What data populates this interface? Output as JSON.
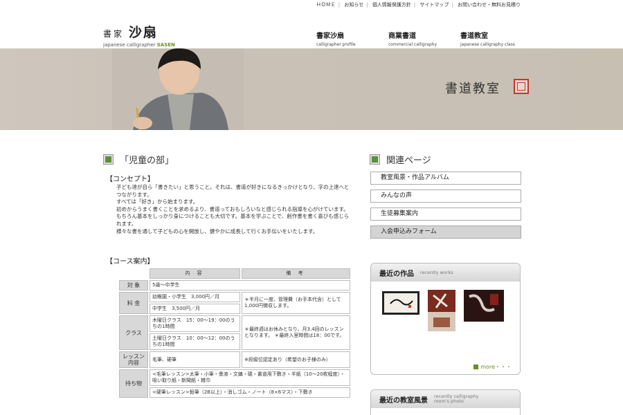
{
  "top_nav": [
    "ＨＯＭＥ",
    "お知らせ",
    "個人情報保護方針",
    "サイトマップ",
    "お問い合わせ・無料お見積り"
  ],
  "logo": {
    "line1_small": "書家",
    "line1_big": "沙扇",
    "line2_prefix": "japanese calligrapher ",
    "line2_accent": "SASEN"
  },
  "main_nav": [
    {
      "jp": "書家沙扇",
      "en": "calligrapher profile"
    },
    {
      "jp": "商業書道",
      "en": "commercial calligraphy"
    },
    {
      "jp": "書道教室",
      "en": "japanese calligraphy class"
    }
  ],
  "banner": {
    "title": "書道教室"
  },
  "section_title": "「児童の部」",
  "concept": {
    "heading": "【コンセプト】",
    "paragraphs": [
      "子ども達が自ら「書きたい」と思うこと。それは、書道が好きになるきっかけとなり、字の上達へとつながります。",
      "すべては「好き」から始まります。",
      "初めからうまく書くことを求めるより、書道っておもしろいなと感じられる指導を心がけています。",
      "もちろん基本をしっかり身につけることも大切です。基本を学ぶことで、創作書を書く喜びも感じられます。",
      "様々な書を通して子どもの心を開放し、健やかに成長して行くお手伝いをいたします。"
    ]
  },
  "course": {
    "heading": "【コース案内】",
    "col_content": "内 容",
    "col_note": "備 考",
    "r_target_label": "対 象",
    "r_target_value": "5歳～中学生",
    "r_fee_label": "料 金",
    "r_fee_1": "幼稚園・小学生　3,000円／月",
    "r_fee_note": "＊半月に一度、管理費（お手本代含）として1,000円徴収します。",
    "r_fee_2": "中学生　3,500円／月",
    "r_class_label": "クラス",
    "r_class_1": "木曜日クラス　15：00～19：00のうちの1時間",
    "r_class_note": "＊最終週はお休みとなり、月3,4回のレッスンとなります。 ＊最終入室時間は18：00です。",
    "r_class_2": "土曜日クラス　10：00～12：00のうちの1時間",
    "r_lesson_label": "レッスン内容",
    "r_lesson_value": "毛筆、硬筆",
    "r_lesson_note": "※段級位認定あり（希望のお子様のみ）",
    "r_items_label": "持ち物",
    "r_items_1": "<毛筆レッスン>太筆・小筆・墨液・文鎮・硯・書道用下敷き・半紙（10～20枚程度）・吸い取り紙・新聞紙・雑巾",
    "r_items_2": "<硬筆レッスン>鉛筆（2B以上）・消しゴム・ノート（8×6マス）・下敷き"
  },
  "related": {
    "title": "関連ページ",
    "links": [
      "教室風景・作品アルバム",
      "みんなの声",
      "生徒募集案内",
      "入会申込みフォーム"
    ]
  },
  "recent_works": {
    "title": "最近の作品",
    "subtitle": "recently works",
    "more": "more・・・"
  },
  "recent_room": {
    "title": "最近の教室風景",
    "subtitle": "recently calligraphy room's photo"
  },
  "colors": {
    "accent_green": "#5e8f3a",
    "banner_bg": "#c9c1b6",
    "seal_red": "#c0392b"
  }
}
